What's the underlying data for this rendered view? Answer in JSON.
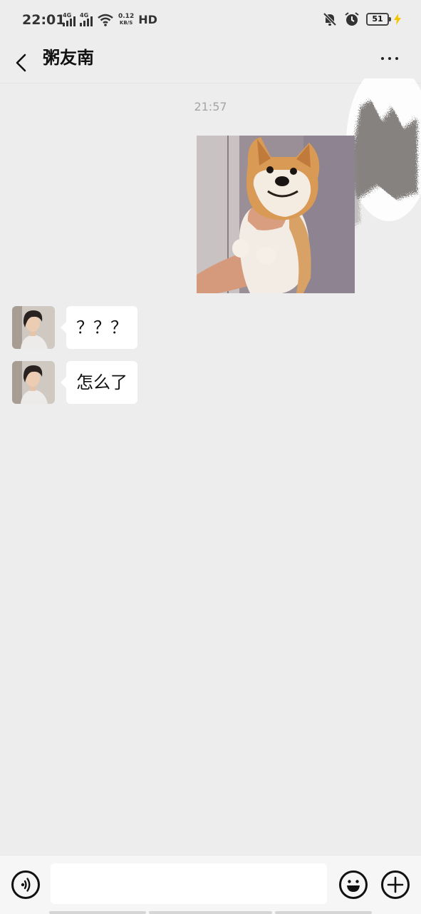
{
  "status_bar": {
    "time": "22:01",
    "network_1": "4G",
    "network_2": "4G",
    "speed_value": "0.12",
    "speed_unit": "KB/S",
    "hd_label": "HD",
    "battery": "51",
    "icons": [
      "signal-4g-icon",
      "signal-4g-icon",
      "wifi-icon",
      "mute-bell-icon",
      "alarm-icon",
      "battery-icon",
      "charging-icon"
    ]
  },
  "nav": {
    "title": "粥友南",
    "back_icon": "chevron-left-icon",
    "more_icon": "more-dots-icon"
  },
  "chat": {
    "timestamp": "21:57",
    "messages": [
      {
        "type": "image",
        "sender": "me",
        "content": "shiba-dog-photo"
      },
      {
        "type": "text",
        "sender": "contact",
        "text": "？？？"
      },
      {
        "type": "text",
        "sender": "contact",
        "text": "怎么了"
      }
    ]
  },
  "input_bar": {
    "input_value": "",
    "input_placeholder": "",
    "voice_icon": "voice-icon",
    "emoji_icon": "emoji-icon",
    "plus_icon": "plus-icon"
  }
}
